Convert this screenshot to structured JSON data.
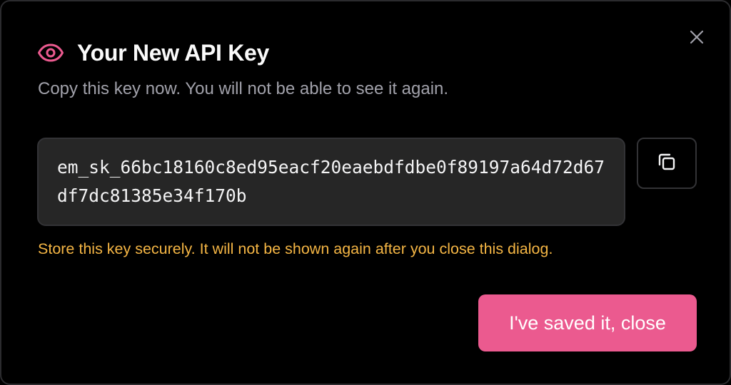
{
  "dialog": {
    "title": "Your New API Key",
    "subtitle": "Copy this key now. You will not be able to see it again.",
    "api_key": "em_sk_66bc18160c8ed95eacf20eaebdfdbe0f89197a64d72d67df7dc81385e34f170b",
    "warning": "Store this key securely. It will not be shown again after you close this dialog.",
    "confirm_label": "I've saved it, close"
  },
  "icons": {
    "title_icon": "eye-icon",
    "copy_icon": "copy-icon",
    "close_icon": "close-icon"
  },
  "colors": {
    "accent": "#eb5a8f",
    "warning": "#f4b544",
    "background": "#000000",
    "key_box": "#262626"
  }
}
